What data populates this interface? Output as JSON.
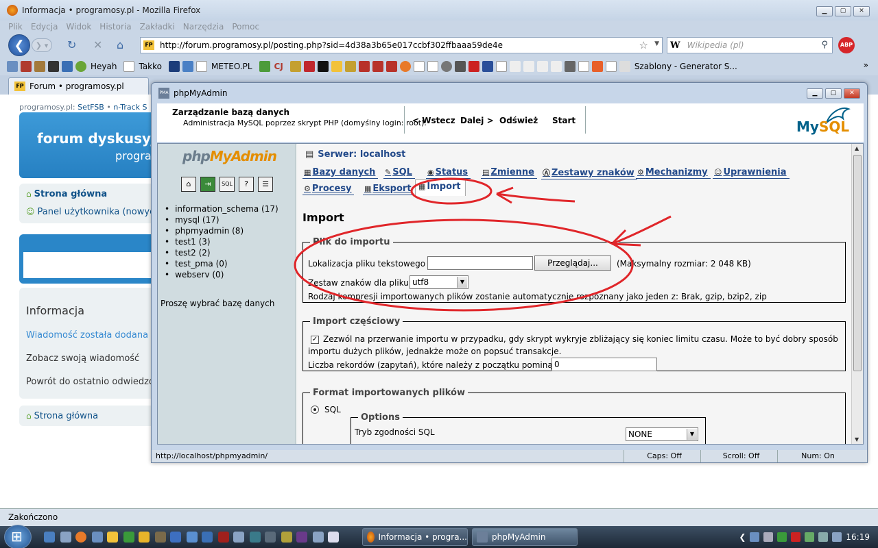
{
  "firefox": {
    "window_title": "Informacja • programosy.pl - Mozilla Firefox",
    "menu": [
      "Plik",
      "Edycja",
      "Widok",
      "Historia",
      "Zakładki",
      "Narzędzia",
      "Pomoc"
    ],
    "url": "http://forum.programosy.pl/posting.php?sid=4d38a3b65e017ccbf302ffbaaa59de4e",
    "search_placeholder": "Wikipedia (pl)",
    "search_engine_icon": "W",
    "abp_label": "ABP",
    "bookmarks": [
      "Heyah",
      "Takko",
      "METEO.PL",
      "CJ",
      "Szablony - Generator S..."
    ],
    "tab_label": "Forum • programosy.pl",
    "favicon_text": "FP",
    "status": "Zakończono"
  },
  "webpage": {
    "crumb_prefix": "programosy.pl:",
    "crumb_links": [
      "SetFSB",
      "n-Track S"
    ],
    "header_title": "forum dyskusyjn",
    "header_sub": "program",
    "home_link": "Strona główna",
    "user_panel": "Panel użytkownika (nowych w",
    "info_title": "Informacja",
    "info_msg": "Wiadomość została dodana p",
    "info_see": "Zobacz swoją wiadomość",
    "info_back": "Powrót do ostatnio odwiedzo",
    "home_link_bottom": "Strona główna"
  },
  "pma": {
    "window_title": "phpMyAdmin",
    "favicon_text": "PMA",
    "toolbar_heading": "Zarządzanie bazą danych",
    "toolbar_sub": "Administracja MySQL poprzez skrypt PHP (domyślny login: root).",
    "nav": {
      "back": "< Wstecz",
      "next": "Dalej >",
      "refresh": "Odśwież",
      "start": "Start"
    },
    "logo_php": "php",
    "logo_myadmin": "MyAdmin",
    "mysql_my": "My",
    "mysql_sql": "SQL",
    "databases": [
      "information_schema (17)",
      "mysql (17)",
      "phpmyadmin (8)",
      "test1 (3)",
      "test2 (2)",
      "test_pma (0)",
      "webserv (0)"
    ],
    "choose_db": "Proszę wybrać bazę danych",
    "server": "Serwer: localhost",
    "tabs": {
      "bazy": "Bazy danych",
      "sql": "SQL",
      "status": "Status",
      "zmienne": "Zmienne",
      "zestawy": "Zestawy znaków",
      "mechanizmy": "Mechanizmy",
      "uprawnienia": "Uprawnienia",
      "procesy": "Procesy",
      "eksport": "Eksport",
      "import": "Import"
    },
    "import_heading": "Import",
    "file_section": {
      "legend": "Plik do importu",
      "location_label": "Lokalizacja pliku tekstowego",
      "browse_button": "Przeglądaj...",
      "max_size": "(Maksymalny rozmiar: 2 048 KB)",
      "charset_label": "Zestaw znaków dla pliku:",
      "charset_value": "utf8",
      "compression_note": "Rodzaj kompresji importowanych plików zostanie automatycznie rozpoznany jako jeden z: Brak, gzip, bzip2, zip"
    },
    "partial_section": {
      "legend": "Import częściowy",
      "allow_interrupt_line1": "Zezwól na przerwanie importu w przypadku, gdy skrypt wykryje zbliżający się koniec limitu czasu. Może to być dobry sposób",
      "allow_interrupt_line2": "importu dużych plików, jednakże może on popsuć transakcje.",
      "skip_label": "Liczba rekordów (zapytań), które należy z początku pominąć",
      "skip_value": "0"
    },
    "format_section": {
      "legend": "Format importowanych plików",
      "sql_option": "SQL",
      "options_legend": "Options",
      "compat_label": "Tryb zgodności SQL",
      "compat_value": "NONE"
    },
    "statusbar": {
      "url": "http://localhost/phpmyadmin/",
      "caps": "Caps: Off",
      "scroll": "Scroll: Off",
      "num": "Num: On"
    }
  },
  "taskbar": {
    "task1": "Informacja • progra...",
    "task2": "phpMyAdmin",
    "clock": "16:19"
  },
  "colors": {
    "link_blue": "#234a8a",
    "annotation_red": "#e0262a",
    "forum_blue": "#2a86c8"
  }
}
